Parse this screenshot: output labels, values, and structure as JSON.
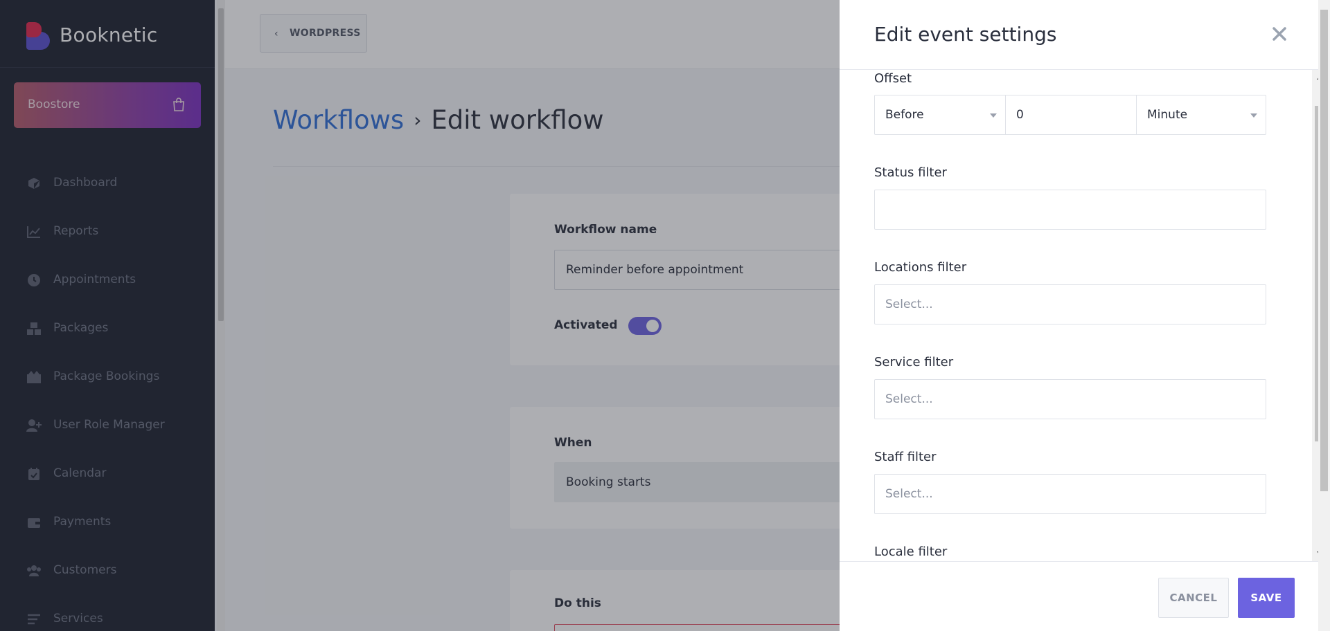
{
  "sidebar": {
    "brand": "Booknetic",
    "boostore": "Boostore",
    "items": [
      {
        "label": "Dashboard",
        "icon": "dashboard-icon"
      },
      {
        "label": "Reports",
        "icon": "reports-icon"
      },
      {
        "label": "Appointments",
        "icon": "clock-icon"
      },
      {
        "label": "Packages",
        "icon": "packages-icon"
      },
      {
        "label": "Package Bookings",
        "icon": "package-bookings-icon"
      },
      {
        "label": "User Role Manager",
        "icon": "user-plus-icon"
      },
      {
        "label": "Calendar",
        "icon": "calendar-icon"
      },
      {
        "label": "Payments",
        "icon": "wallet-icon"
      },
      {
        "label": "Customers",
        "icon": "users-icon"
      },
      {
        "label": "Services",
        "icon": "list-icon"
      }
    ]
  },
  "topbar": {
    "wordpress_label": "WORDPRESS"
  },
  "breadcrumb": {
    "link": "Workflows",
    "separator": "›",
    "current": "Edit workflow"
  },
  "workflow": {
    "name_label": "Workflow name",
    "name_value": "Reminder before appointment",
    "activated_label": "Activated",
    "when_label": "When",
    "when_value": "Booking starts",
    "do_label": "Do this"
  },
  "drawer": {
    "title": "Edit event settings",
    "offset_label": "Offset",
    "offset_direction": "Before",
    "offset_amount": "0",
    "offset_unit": "Minute",
    "status_filter_label": "Status filter",
    "locations_filter_label": "Locations filter",
    "locations_placeholder": "Select...",
    "service_filter_label": "Service filter",
    "service_placeholder": "Select...",
    "staff_filter_label": "Staff filter",
    "staff_placeholder": "Select...",
    "locale_filter_label": "Locale filter",
    "cancel_label": "CANCEL",
    "save_label": "SAVE"
  },
  "colors": {
    "accent": "#6c63e0",
    "link": "#2f6fd6",
    "sidebar_bg": "#1d2230"
  }
}
